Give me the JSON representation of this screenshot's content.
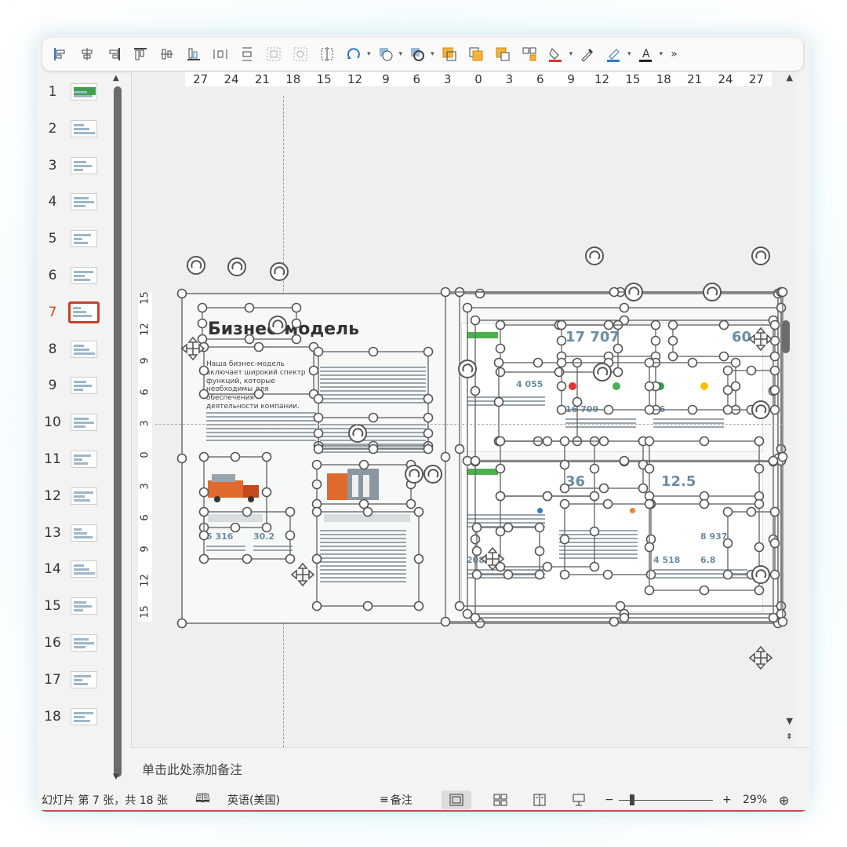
{
  "toolbar": {
    "tools": [
      "align-left-icon",
      "align-center-icon",
      "align-right-icon",
      "align-top-icon",
      "align-middle-icon",
      "align-bottom-icon",
      "distribute-horizontal-icon",
      "distribute-vertical-icon",
      "group-icon",
      "ungroup-icon",
      "crop-icon",
      "rotate-icon",
      "shape-outline-icon",
      "shape-effects-icon",
      "bring-forward-icon",
      "send-backward-icon",
      "arrange-icon",
      "selection-pane-icon",
      "fill-color-icon",
      "eyedropper-icon",
      "outline-color-icon",
      "font-color-icon"
    ],
    "more": "»",
    "fill_color": "#d9382f",
    "outline_color": "#2f79c9"
  },
  "thumbnails": [
    {
      "num": "1"
    },
    {
      "num": "2"
    },
    {
      "num": "3"
    },
    {
      "num": "4"
    },
    {
      "num": "5"
    },
    {
      "num": "6"
    },
    {
      "num": "7",
      "active": true
    },
    {
      "num": "8"
    },
    {
      "num": "9"
    },
    {
      "num": "10"
    },
    {
      "num": "11"
    },
    {
      "num": "12"
    },
    {
      "num": "13"
    },
    {
      "num": "14"
    },
    {
      "num": "15"
    },
    {
      "num": "16"
    },
    {
      "num": "17"
    },
    {
      "num": "18"
    }
  ],
  "ruler": {
    "horizontal": [
      "27",
      "24",
      "21",
      "18",
      "15",
      "12",
      "9",
      "6",
      "3",
      "0",
      "3",
      "6",
      "9",
      "12",
      "15",
      "18",
      "21",
      "24",
      "27"
    ],
    "vertical": [
      "15",
      "12",
      "9",
      "6",
      "3",
      "0",
      "3",
      "6",
      "9",
      "12",
      "15"
    ]
  },
  "slide": {
    "title": "Бизнес-модель",
    "intro": "Наша бизнес-модель включает широкий спектр функций, которые необходимы для обеспечения деятельности компании.",
    "stat_1": "5 316",
    "stat_2": "30.2",
    "stat_3": "17 707",
    "stat_4": "60",
    "stat_5": "4 055",
    "stat_6": "16 709",
    "stat_7": "56",
    "stat_8": "36",
    "stat_9": "12.5",
    "stat_10": "208",
    "stat_11": "4 518",
    "stat_12": "8 937",
    "stat_13": "6.8"
  },
  "notes": {
    "placeholder": "单击此处添加备注"
  },
  "status": {
    "slide_info": "幻灯片 第 7 张，共 18 张",
    "language": "英语(美国)",
    "notes_btn": "备注",
    "zoom_minus": "−",
    "zoom_plus": "+",
    "zoom": "29%"
  }
}
